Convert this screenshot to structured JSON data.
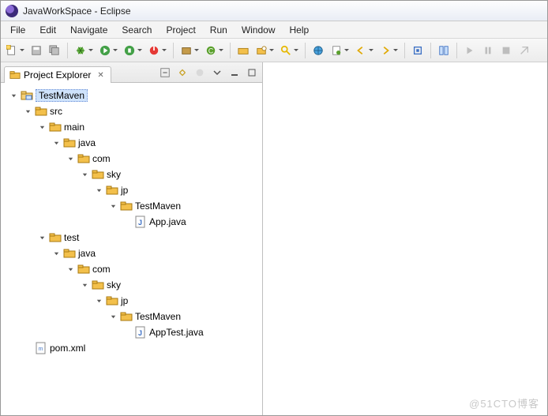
{
  "window": {
    "title": "JavaWorkSpace - Eclipse"
  },
  "menu": [
    "File",
    "Edit",
    "Navigate",
    "Search",
    "Project",
    "Run",
    "Window",
    "Help"
  ],
  "view": {
    "title": "Project Explorer",
    "close_glyph": "✕"
  },
  "tree": [
    {
      "depth": 0,
      "label": "TestMaven",
      "icon": "project",
      "expanded": true,
      "selected": true
    },
    {
      "depth": 1,
      "label": "src",
      "icon": "folder",
      "expanded": true
    },
    {
      "depth": 2,
      "label": "main",
      "icon": "folder",
      "expanded": true
    },
    {
      "depth": 3,
      "label": "java",
      "icon": "folder",
      "expanded": true
    },
    {
      "depth": 4,
      "label": "com",
      "icon": "folder",
      "expanded": true
    },
    {
      "depth": 5,
      "label": "sky",
      "icon": "folder",
      "expanded": true
    },
    {
      "depth": 6,
      "label": "jp",
      "icon": "folder",
      "expanded": true
    },
    {
      "depth": 7,
      "label": "TestMaven",
      "icon": "folder",
      "expanded": true
    },
    {
      "depth": 8,
      "label": "App.java",
      "icon": "java",
      "leaf": true
    },
    {
      "depth": 2,
      "label": "test",
      "icon": "folder",
      "expanded": true
    },
    {
      "depth": 3,
      "label": "java",
      "icon": "folder",
      "expanded": true
    },
    {
      "depth": 4,
      "label": "com",
      "icon": "folder",
      "expanded": true
    },
    {
      "depth": 5,
      "label": "sky",
      "icon": "folder",
      "expanded": true
    },
    {
      "depth": 6,
      "label": "jp",
      "icon": "folder",
      "expanded": true
    },
    {
      "depth": 7,
      "label": "TestMaven",
      "icon": "folder",
      "expanded": true
    },
    {
      "depth": 8,
      "label": "AppTest.java",
      "icon": "java",
      "leaf": true
    },
    {
      "depth": 1,
      "label": "pom.xml",
      "icon": "xml",
      "leaf": true
    }
  ],
  "watermark": "@51CTO博客"
}
